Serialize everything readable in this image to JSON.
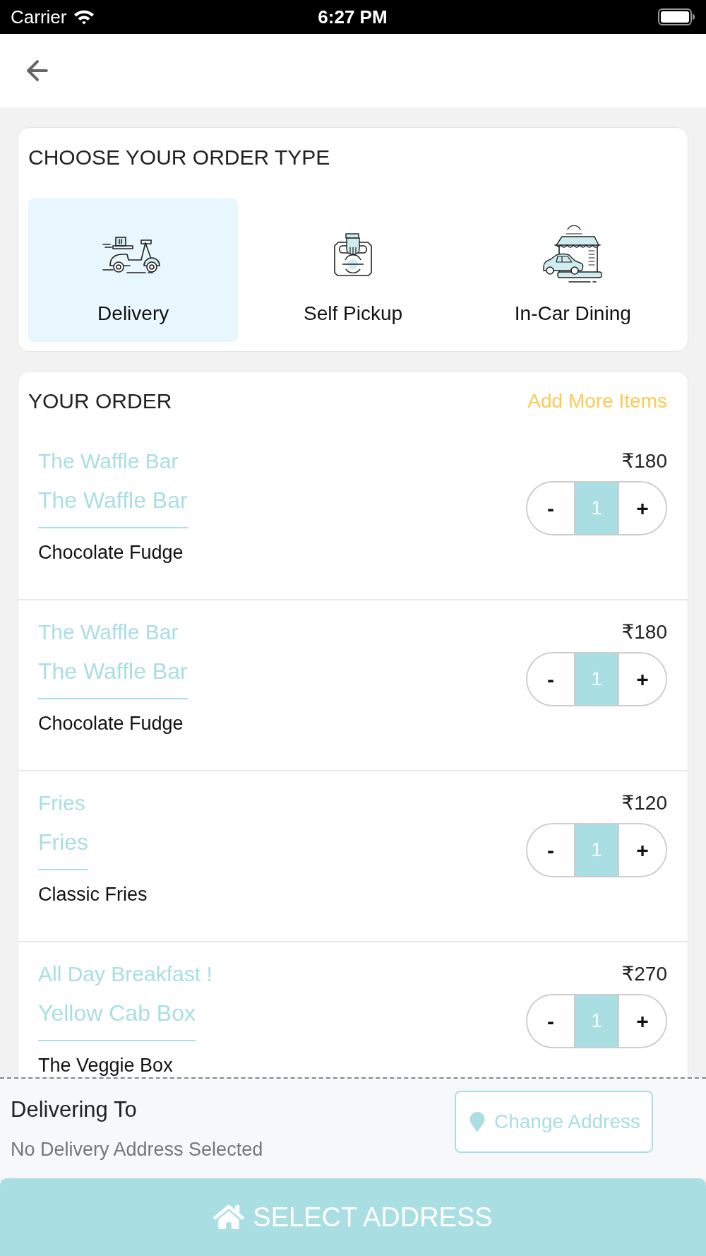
{
  "status_bar": {
    "carrier": "Carrier",
    "time": "6:27 PM"
  },
  "order_type": {
    "title": "CHOOSE YOUR ORDER TYPE",
    "options": [
      {
        "label": "Delivery",
        "kind": "scooter",
        "selected": true
      },
      {
        "label": "Self Pickup",
        "kind": "bag",
        "selected": false
      },
      {
        "label": "In-Car Dining",
        "kind": "drive_in",
        "selected": false
      }
    ]
  },
  "order": {
    "title": "YOUR ORDER",
    "add_more": "Add More Items",
    "items": [
      {
        "restaurant": "The Waffle Bar",
        "category": "The Waffle Bar",
        "name": "Chocolate Fudge",
        "price": "₹180",
        "decrement": "-",
        "quantity": "1",
        "increment": "+"
      },
      {
        "restaurant": "The Waffle Bar",
        "category": "The Waffle Bar",
        "name": "Chocolate Fudge",
        "price": "₹180",
        "decrement": "-",
        "quantity": "1",
        "increment": "+"
      },
      {
        "restaurant": "Fries",
        "category": "Fries",
        "name": "Classic Fries",
        "price": "₹120",
        "decrement": "-",
        "quantity": "1",
        "increment": "+"
      },
      {
        "restaurant": "All Day Breakfast !",
        "category": "Yellow Cab Box",
        "name": "The Veggie Box",
        "price": "₹270",
        "decrement": "-",
        "quantity": "1",
        "increment": "+"
      }
    ]
  },
  "delivery": {
    "label": "Delivering To",
    "address": "No Delivery Address Selected",
    "change_button": "Change Address"
  },
  "select_button": "SELECT ADDRESS"
}
